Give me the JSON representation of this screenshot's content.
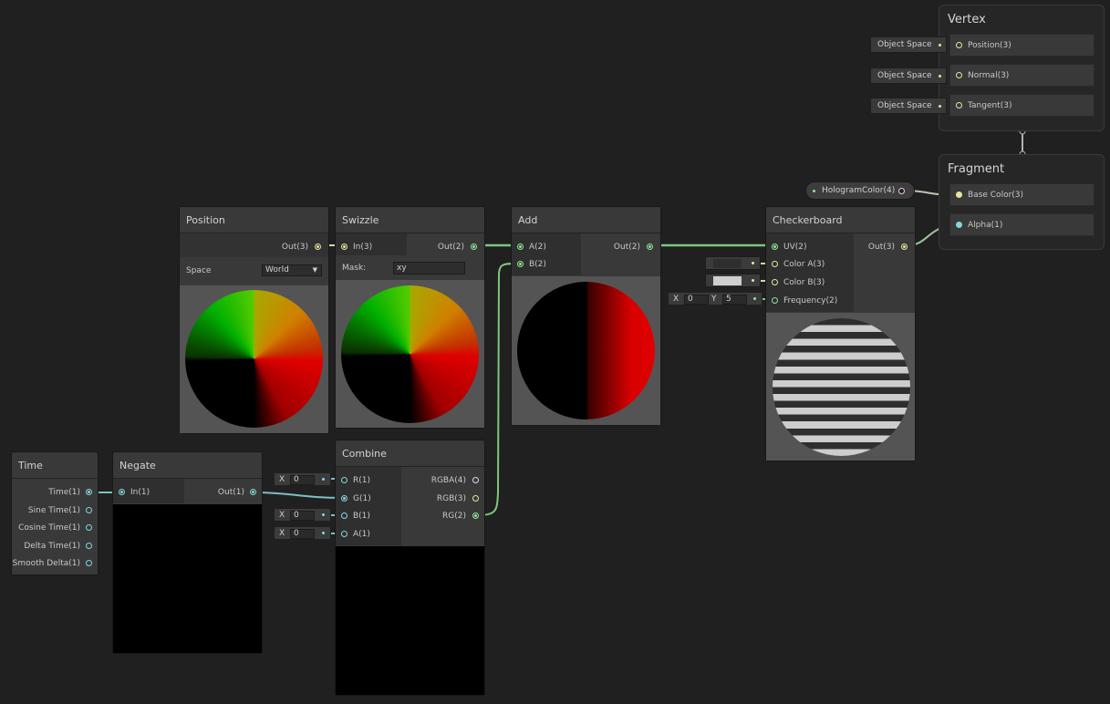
{
  "colors": {
    "canvas": "#202020",
    "node_body": "#393939",
    "vec3_port": "#e8e4a0",
    "vec2_port": "#93e597",
    "vec1_port": "#86d6da",
    "vec4_port": "#f0c6ee",
    "wire_vec2": "#7dc77c",
    "wire_vec1": "#7ebfc4"
  },
  "nodes": {
    "position": {
      "title": "Position",
      "out_label": "Out(3)",
      "space_label": "Space",
      "space_value": "World"
    },
    "swizzle": {
      "title": "Swizzle",
      "in_label": "In(3)",
      "out_label": "Out(2)",
      "mask_label": "Mask:",
      "mask_value": "xy"
    },
    "add": {
      "title": "Add",
      "in_a": "A(2)",
      "in_b": "B(2)",
      "out_label": "Out(2)"
    },
    "checkerboard": {
      "title": "Checkerboard",
      "in_uv": "UV(2)",
      "in_color_a": "Color A(3)",
      "in_color_b": "Color B(3)",
      "in_frequency": "Frequency(2)",
      "out_label": "Out(3)",
      "color_a": "#2f2f2f",
      "color_b": "#cfcfcf",
      "freq_x_label": "X",
      "freq_x_value": "0",
      "freq_y_label": "Y",
      "freq_y_value": "5"
    },
    "time": {
      "title": "Time",
      "outputs": [
        "Time(1)",
        "Sine Time(1)",
        "Cosine Time(1)",
        "Delta Time(1)",
        "Smooth Delta(1)"
      ]
    },
    "negate": {
      "title": "Negate",
      "in_label": "In(1)",
      "out_label": "Out(1)"
    },
    "combine": {
      "title": "Combine",
      "inputs": [
        "R(1)",
        "G(1)",
        "B(1)",
        "A(1)"
      ],
      "outputs": [
        "RGBA(4)",
        "RGB(3)",
        "RG(2)"
      ],
      "r_label": "X",
      "r_value": "0",
      "b_label": "X",
      "b_value": "0",
      "a_label": "X",
      "a_value": "0"
    }
  },
  "vertex": {
    "title": "Vertex",
    "slots": [
      "Position(3)",
      "Normal(3)",
      "Tangent(3)"
    ],
    "space_label": "Object Space"
  },
  "fragment": {
    "title": "Fragment",
    "slots": [
      "Base Color(3)",
      "Alpha(1)"
    ]
  },
  "property": {
    "label": "HologramColor(4)"
  }
}
